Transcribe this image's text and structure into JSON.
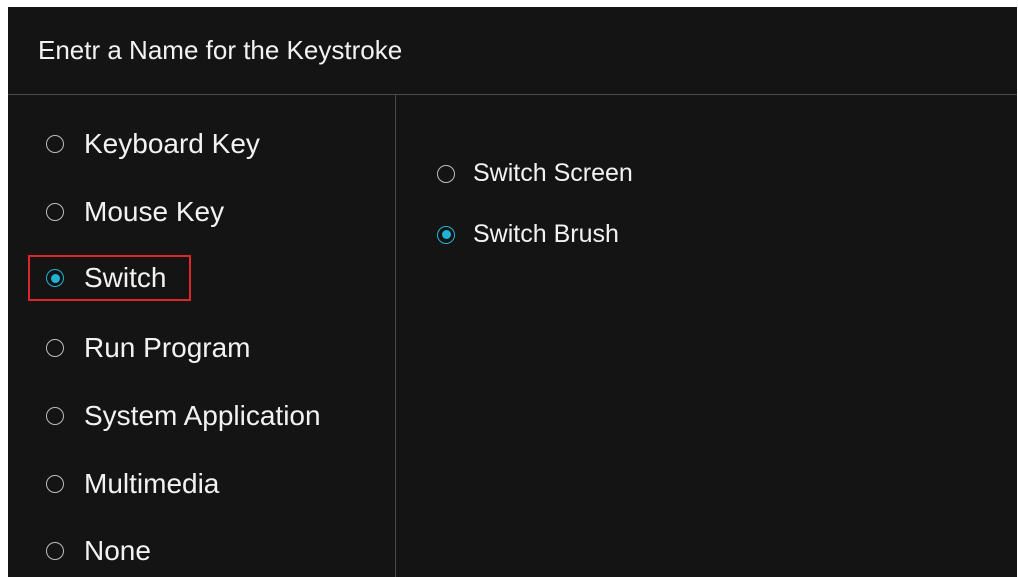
{
  "dialog": {
    "title": "Enetr a Name for the Keystroke"
  },
  "key_types": {
    "selected": "Switch",
    "options": [
      {
        "label": "Keyboard Key",
        "checked": false
      },
      {
        "label": "Mouse Key",
        "checked": false
      },
      {
        "label": "Switch",
        "checked": true
      },
      {
        "label": "Run Program",
        "checked": false
      },
      {
        "label": "System Application",
        "checked": false
      },
      {
        "label": "Multimedia",
        "checked": false
      },
      {
        "label": "None",
        "checked": false
      }
    ]
  },
  "switch_options": {
    "selected": "Switch Brush",
    "options": [
      {
        "label": "Switch Screen",
        "checked": false
      },
      {
        "label": "Switch Brush",
        "checked": true
      }
    ]
  },
  "colors": {
    "background": "#141414",
    "text": "#f2f2f2",
    "accent": "#21b3d3",
    "highlight_border": "#e0262a",
    "divider": "#4a4a4a"
  }
}
